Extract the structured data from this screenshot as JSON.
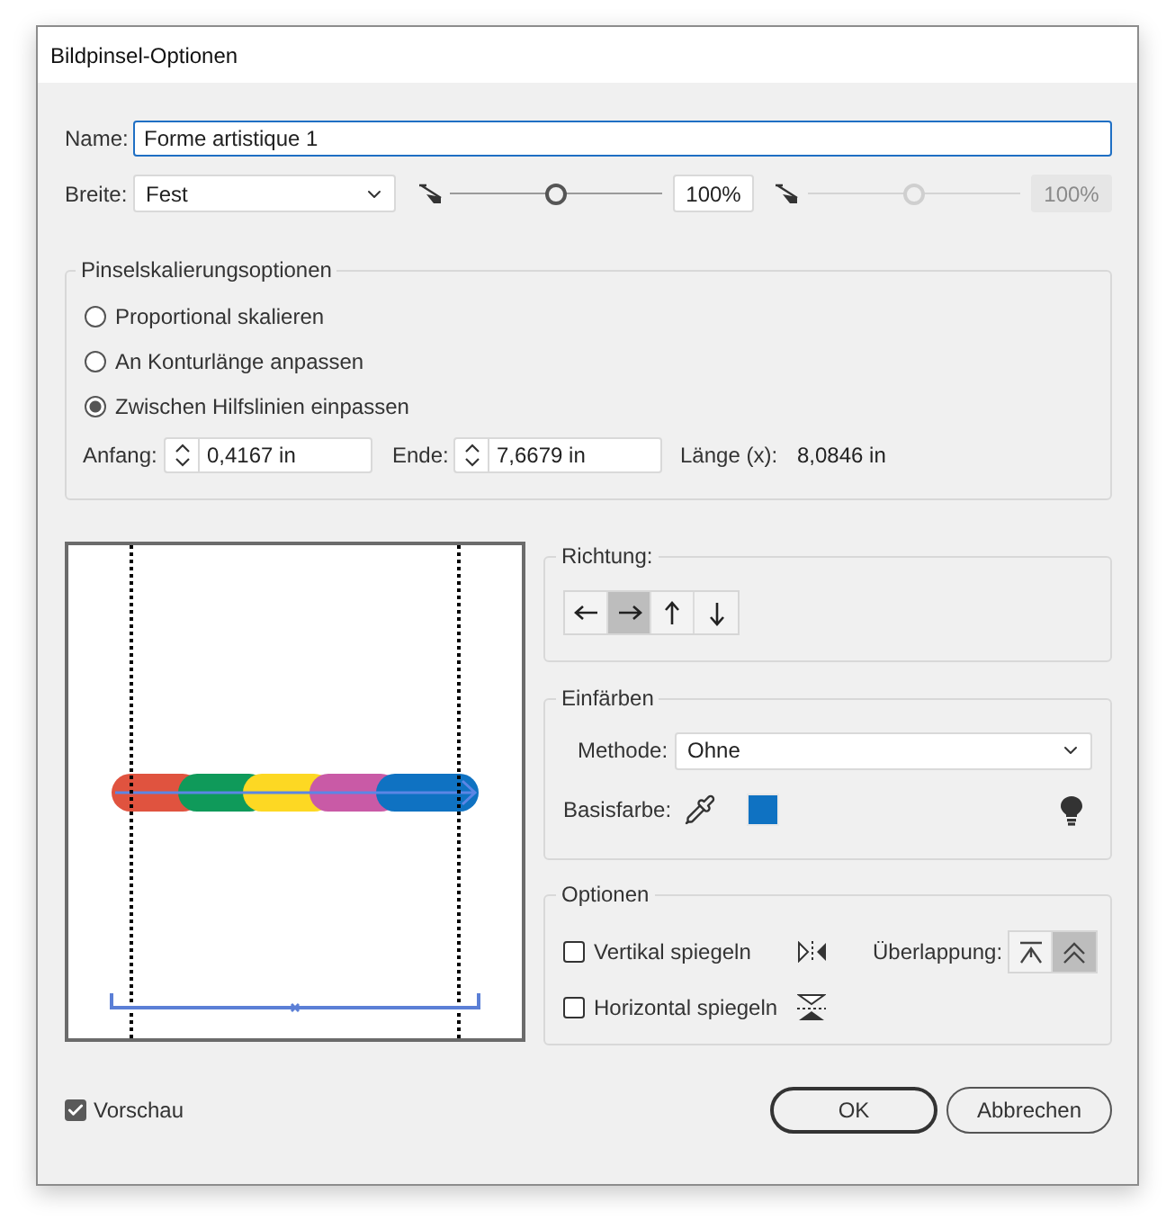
{
  "window": {
    "title": "Bildpinsel-Optionen"
  },
  "name": {
    "label": "Name:",
    "value": "Forme artistique 1"
  },
  "width": {
    "label": "Breite:",
    "value": "Fest",
    "sliders": [
      {
        "level": 0.5,
        "reading": "100%",
        "disabled": false
      },
      {
        "level": 0.5,
        "reading": "100%",
        "disabled": true
      }
    ]
  },
  "scaling": {
    "title": "Pinselskalierungsoptionen",
    "options": [
      {
        "label": "Proportional skalieren",
        "selected": false
      },
      {
        "label": "An Konturlänge anpassen",
        "selected": false
      },
      {
        "label": "Zwischen Hilfslinien einpassen",
        "selected": true
      }
    ],
    "fields": [
      {
        "label": "Anfang:",
        "value": "0,4167 in"
      },
      {
        "label": "Ende:",
        "value": "7,6679 in"
      }
    ],
    "length": {
      "label": "Länge (x):",
      "value": "8,0846 in"
    }
  },
  "direction": {
    "title": "Richtung:",
    "buttons": [
      {
        "kind": "left",
        "selected": false
      },
      {
        "kind": "right",
        "selected": true
      },
      {
        "kind": "up",
        "selected": false
      },
      {
        "kind": "down",
        "selected": false
      }
    ]
  },
  "colorize": {
    "title": "Einfärben",
    "method": {
      "label": "Methode:",
      "value": "Ohne"
    },
    "base_color": {
      "label": "Basisfarbe:",
      "color": "#0f72c2"
    }
  },
  "options": {
    "title": "Optionen",
    "flips": [
      {
        "kind": "vertical",
        "label": "Vertikal spiegeln",
        "checked": false
      },
      {
        "kind": "horizontal",
        "label": "Horizontal spiegeln",
        "checked": false
      }
    ],
    "overlap": {
      "label": "Überlappung:",
      "buttons": [
        {
          "kind": "corner",
          "selected": false
        },
        {
          "kind": "chevrons",
          "selected": true
        }
      ]
    }
  },
  "preview": {
    "label": "Vorschau",
    "checked": true
  },
  "buttons": [
    {
      "label": "OK",
      "default": true
    },
    {
      "label": "Abbrechen",
      "default": false
    }
  ]
}
